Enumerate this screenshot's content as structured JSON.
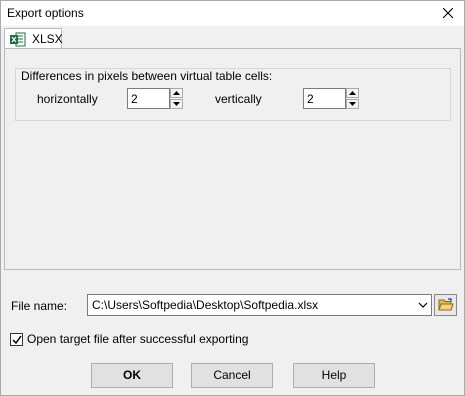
{
  "window": {
    "title": "Export options"
  },
  "tabs": [
    {
      "label": "XLSX",
      "icon": "excel-icon",
      "active": true
    }
  ],
  "group": {
    "title": "Differences in pixels between virtual table cells:",
    "horizontal": {
      "label": "horizontally",
      "value": "2"
    },
    "vertical": {
      "label": "vertically",
      "value": "2"
    }
  },
  "file": {
    "label": "File name:",
    "path": "C:\\Users\\Softpedia\\Desktop\\Softpedia.xlsx"
  },
  "open_after": {
    "label": "Open target file after successful exporting",
    "checked": true
  },
  "buttons": {
    "ok": "OK",
    "cancel": "Cancel",
    "help": "Help"
  },
  "colors": {
    "excel_green": "#1d6f42",
    "folder_yellow": "#e8b84a"
  }
}
